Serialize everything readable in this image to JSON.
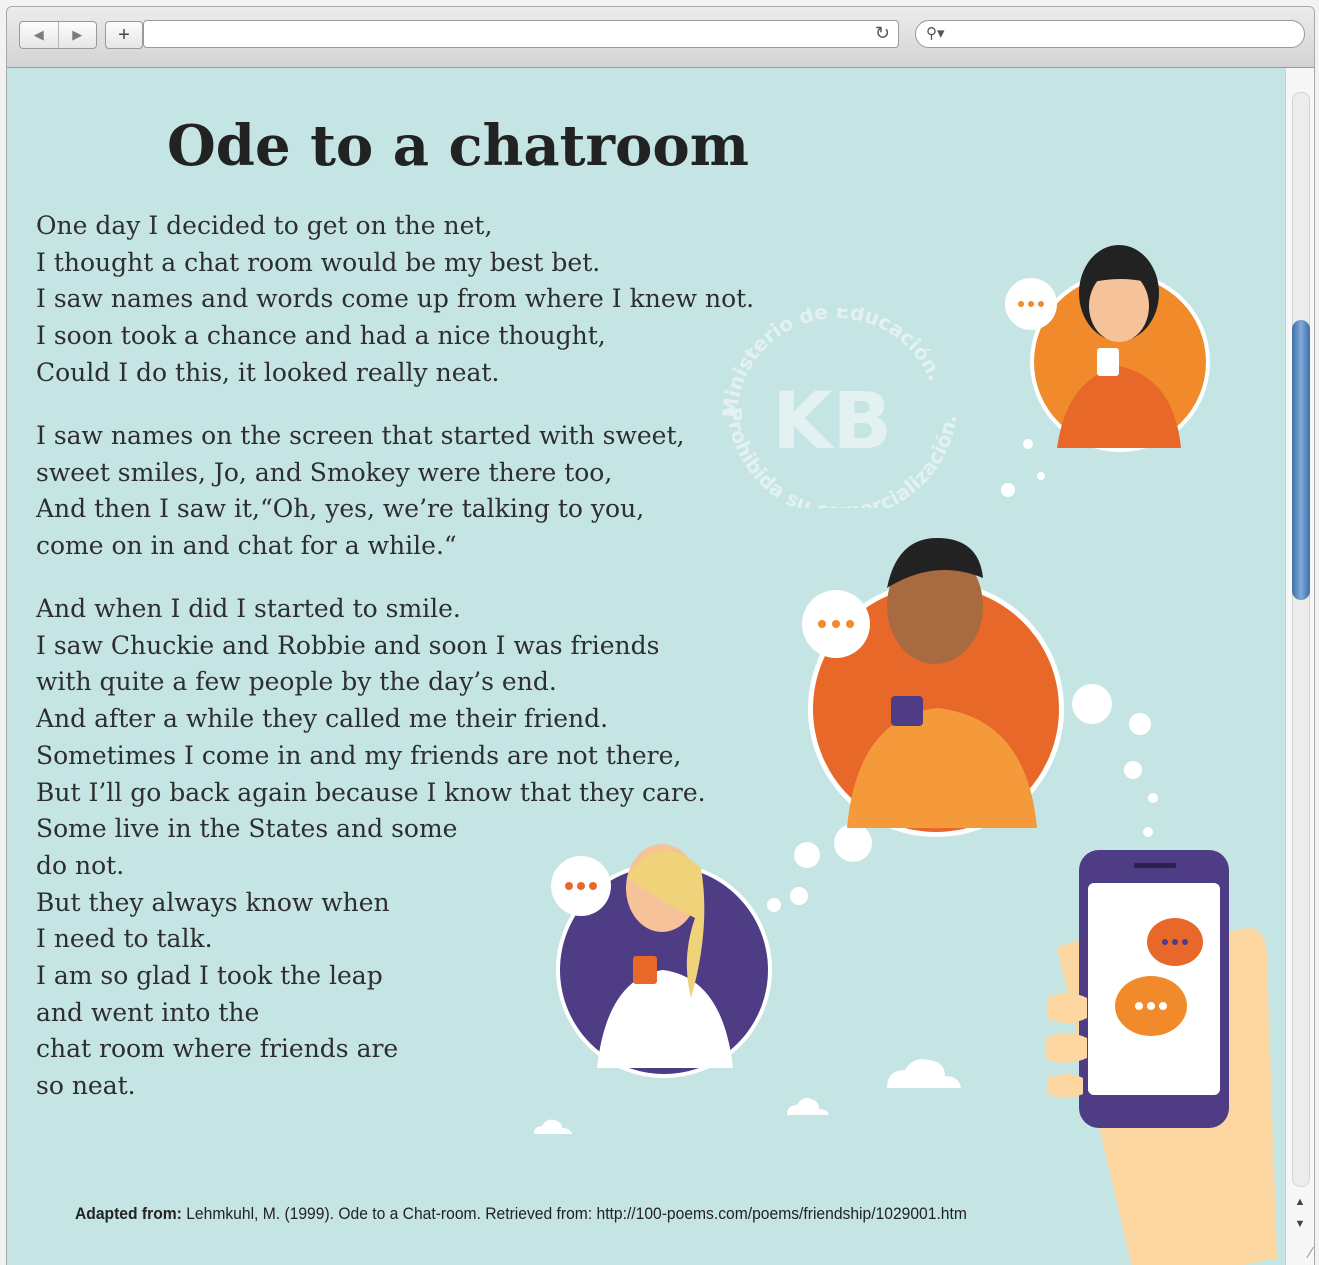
{
  "browser": {
    "nav": {
      "back_icon": "back-arrow-icon",
      "forward_icon": "forward-arrow-icon"
    },
    "new_tab_label": "+",
    "address": {
      "value": ""
    },
    "search": {
      "value": ""
    }
  },
  "page": {
    "title": "Ode to a chatroom",
    "stanzas": [
      {
        "lines": [
          "One day I decided to get on the net,",
          "I thought a chat room would be my best bet.",
          "I saw names and words come up from where I knew not.",
          "I soon took a chance and had a nice thought,",
          "Could I do this, it looked really neat."
        ]
      },
      {
        "lines": [
          "I saw names on the screen that started with sweet,",
          "sweet smiles, Jo, and Smokey were there too,",
          "And then I saw it,“Oh, yes, we’re talking to you,",
          "come on in and chat for a while.“"
        ]
      },
      {
        "lines": [
          "And when I did I started to smile.",
          "I saw Chuckie and Robbie and soon I was friends",
          "with quite a few people by the day’s end.",
          "And after a while they called me their friend.",
          "Sometimes I come in and my friends are not there,",
          "But I’ll go back again because I know that they care.",
          "Some live in the States and some",
          "do not.",
          "But they always know when",
          "I need to talk.",
          "I am so glad I took the leap",
          "and went into the",
          "chat room where friends are",
          "so neat."
        ]
      }
    ],
    "caption": {
      "label": "Adapted from:",
      "text": " Lehmkuhl, M. (1999). Ode to a Chat-room. Retrieved from: http://100-poems.com/poems/friendship/1029001.htm"
    },
    "watermark": {
      "top_text": "Ministerio de Educación.",
      "logo_text": "KB",
      "bottom_text": "Prohibida su comercialización."
    },
    "colors": {
      "background": "#c5e5e5",
      "orange": "#f08a2b",
      "dark_orange": "#e8682a",
      "purple": "#4e3c84"
    }
  }
}
